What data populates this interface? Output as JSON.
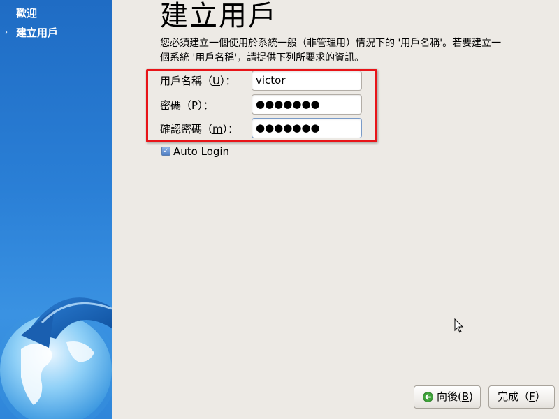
{
  "sidebar": {
    "items": [
      {
        "label": "歡迎",
        "active": false
      },
      {
        "label": "建立用戶",
        "active": true,
        "marker": "›"
      }
    ]
  },
  "page": {
    "title": "建立用戶",
    "description": "您必須建立一個使用於系統一般（非管理用）情況下的 '用戶名稱'。若要建立一個系統 '用戶名稱'，請提供下列所要求的資訊。"
  },
  "form": {
    "username": {
      "label_pre": "用戶名稱（",
      "mnemonic": "U",
      "label_post": "）：",
      "value": "victor"
    },
    "password": {
      "label_pre": "密碼（",
      "mnemonic": "P",
      "label_post": "）：",
      "value": "●●●●●●●"
    },
    "confirm": {
      "label_pre": "確認密碼（",
      "mnemonic": "m",
      "label_post": "）：",
      "value": "●●●●●●●"
    },
    "autologin": {
      "label": "Auto Login",
      "checked": true,
      "check_glyph": "✓"
    }
  },
  "buttons": {
    "back": {
      "label_pre": "向後(",
      "mnemonic": "B",
      "label_post": ")"
    },
    "finish": {
      "label_pre": "完成（",
      "mnemonic": "F",
      "label_post": "）"
    }
  },
  "colors": {
    "highlight": "#e81418",
    "sidebar": "#2a7fd6",
    "background": "#edeae5"
  }
}
